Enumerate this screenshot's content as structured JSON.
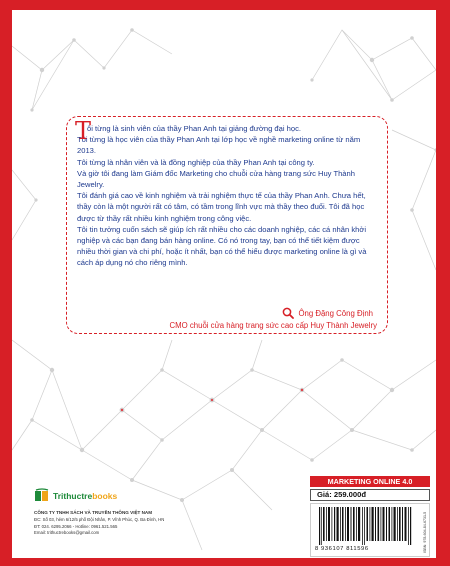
{
  "quote": {
    "drop_cap": "T",
    "paragraphs": [
      "ôi từng là sinh viên của thầy Phan Anh tại giảng đường đại học.",
      "Tôi từng là học viên của thầy Phan Anh tại lớp học về nghề marketing online từ năm 2013.",
      "Tôi từng là nhân viên và là đồng nghiệp của thầy Phan Anh tại công ty.",
      "Và giờ tôi đang làm Giám đốc Marketing cho chuỗi cửa hàng trang sức Huy Thành Jewelry.",
      "Tôi đánh giá cao về kinh nghiệm và trải nghiệm thực tế của thầy Phan Anh. Chưa hết, thầy còn là một người rất có tâm, có tầm trong lĩnh vực mà thầy theo đuổi. Tôi đã học được từ thầy rất nhiều kinh nghiệm trong công việc.",
      "Tôi tin tưởng cuốn sách sẽ giúp ích rất nhiều cho các doanh nghiệp, các cá nhân khởi nghiệp và các bạn đang bán hàng online. Có nó trong tay, bạn có thể tiết kiệm được nhiều thời gian và chi phí, hoặc ít nhất, bạn có thể hiểu được marketing online là gì và cách áp dụng nó cho riêng mình."
    ],
    "signature_name": "Ông Đặng Công Định",
    "signature_title": "CMO chuỗi cửa hàng trang sức cao cấp Huy Thành Jewelry",
    "signature_icon": "search-icon"
  },
  "publisher": {
    "brand_prefix": "Trithuctre",
    "brand_suffix": "books",
    "company": "CÔNG TY TNHH SÁCH VÀ TRUYỀN THÔNG VIỆT NAM",
    "address": "ĐC: Số 03, hẻm 6/12/5 phố Đội Nhân, P. Vĩnh Phúc, Q. Ba Đình, HN",
    "phone": "ĐT: 024. 6295.2066 - Hotline: 0961.521.565",
    "email": "Email: trithuctrebooks@gmail.com"
  },
  "product": {
    "series": "MARKETING ONLINE 4.0",
    "price": "Giá: 259.000đ",
    "barcode_number": "8 936107 811596",
    "isbn": "ISBN: 978-604-84-6731-5"
  },
  "colors": {
    "frame_red": "#d71f26",
    "text_blue": "#1f3b8f",
    "net_gray": "#c9c9c9"
  }
}
